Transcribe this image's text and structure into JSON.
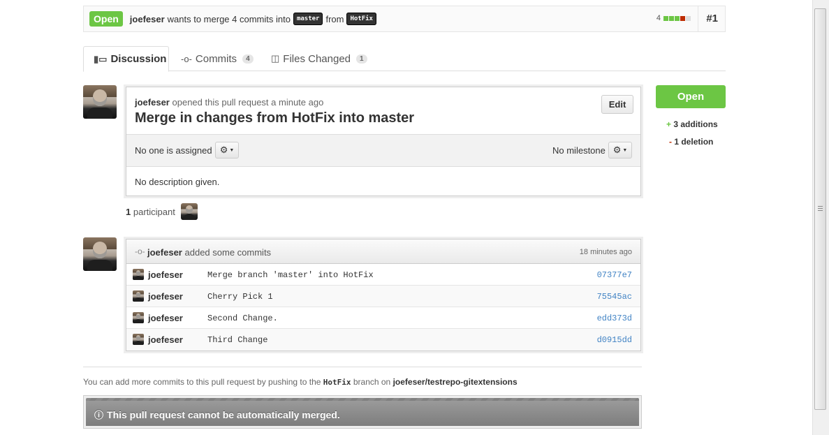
{
  "header": {
    "state": "Open",
    "author": "joefeser",
    "text_before": "wants to merge 4 commits into",
    "base_branch": "master",
    "text_from": "from",
    "head_branch": "HotFix",
    "diffstat_count": "4",
    "diffstat_blocks": [
      "add",
      "add",
      "add",
      "del",
      "neu"
    ],
    "pr_number": "#1"
  },
  "tabs": [
    {
      "label": "Discussion",
      "icon": "discussion-icon"
    },
    {
      "label": "Commits",
      "count": "4",
      "icon": "commit-icon"
    },
    {
      "label": "Files Changed",
      "count": "1",
      "icon": "file-diff-icon"
    }
  ],
  "discussion": {
    "author": "joefeser",
    "meta": "opened this pull request a minute ago",
    "title": "Merge in changes from HotFix into master",
    "edit_label": "Edit",
    "assignee": "No one is assigned",
    "milestone": "No milestone",
    "description": "No description given."
  },
  "participants": {
    "count": "1",
    "label": "participant"
  },
  "commits_block": {
    "author": "joefeser",
    "action": "added some commits",
    "time": "18 minutes ago",
    "commits": [
      {
        "author": "joefeser",
        "message": "Merge branch 'master' into HotFix",
        "sha": "07377e7"
      },
      {
        "author": "joefeser",
        "message": "Cherry Pick 1",
        "sha": "75545ac"
      },
      {
        "author": "joefeser",
        "message": "Second Change.",
        "sha": "edd373d"
      },
      {
        "author": "joefeser",
        "message": "Third Change",
        "sha": "d0915dd"
      }
    ]
  },
  "push_note": {
    "before": "You can add more commits to this pull request by pushing to the",
    "branch": "HotFix",
    "middle": "branch on",
    "repo": "joefeser/testrepo-gitextensions"
  },
  "merge_status": {
    "message": "This pull request cannot be automatically merged."
  },
  "sidebar": {
    "state_button": "Open",
    "additions_sign": "+",
    "additions": "3 additions",
    "deletions_sign": "-",
    "deletions": "1 deletion"
  },
  "colors": {
    "open_green": "#6cc644",
    "deletion_red": "#bd2c00",
    "sha_link": "#4183c4"
  }
}
